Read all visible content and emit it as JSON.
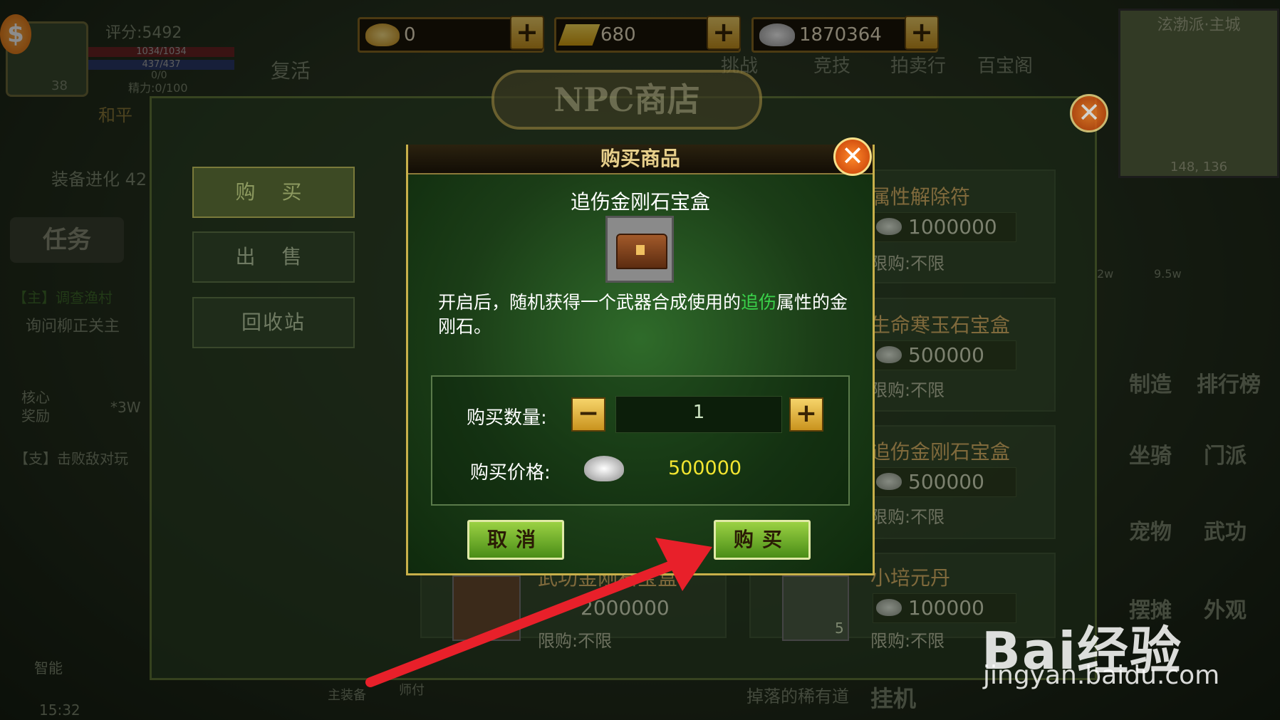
{
  "player": {
    "level": "38",
    "score": "评分:5492",
    "hp": "1034/1034",
    "mp": "437/437",
    "stat3": "0/0",
    "stamina": "精力:0/100",
    "mode": "和平"
  },
  "currencies": [
    {
      "icon": "gold-ingot-icon",
      "value": "0"
    },
    {
      "icon": "gold-bar-icon",
      "value": "680"
    },
    {
      "icon": "silver-ingot-icon",
      "value": "1870364"
    }
  ],
  "top_menu": {
    "revive": "复活",
    "challenge": "挑战",
    "arena": "竞技",
    "auction": "拍卖行",
    "treasure": "百宝阁"
  },
  "minimap": {
    "location": "泫渤派·主城",
    "coords": "148, 136"
  },
  "left_panel": {
    "equip_evolve": "装备进化",
    "equip_evolve_value": "42",
    "task_label": "任务",
    "quest1": "【主】调查渔村",
    "quest1_sub": "询问柳正关主",
    "core_reward": "核心奖励",
    "reward_amount": "*3W",
    "quest2": "【支】击败敌对玩"
  },
  "shop": {
    "title": "NPC商店",
    "tabs": [
      "购 买",
      "出 售",
      "回收站"
    ],
    "items_right": [
      {
        "name": "属性解除符",
        "price": "1000000",
        "limit": "限购:不限"
      },
      {
        "name": "生命寒玉石宝盒",
        "price": "500000",
        "limit": "限购:不限"
      },
      {
        "name": "追伤金刚石宝盒",
        "price": "500000",
        "limit": "限购:不限"
      },
      {
        "name": "小培元丹",
        "price": "100000",
        "limit": "限购:不限",
        "count": "5"
      }
    ],
    "item_left_bottom": {
      "name": "武功金刚石宝盒",
      "price": "2000000",
      "limit": "限购:不限"
    }
  },
  "dialog": {
    "title": "购买商品",
    "item_name": "追伤金刚石宝盒",
    "desc_before": "开启后，随机获得一个武器合成使用的",
    "desc_highlight": "追伤",
    "desc_after": "属性的金刚石。",
    "qty_label": "购买数量:",
    "qty_value": "1",
    "price_label": "购买价格:",
    "price_value": "500000",
    "cancel_label": "取消",
    "buy_label": "购买"
  },
  "right_icons": {
    "craft": "制造",
    "rank": "排行榜",
    "mount": "坐骑",
    "faction": "门派",
    "pet": "宠物",
    "skill": "武功",
    "stall": "摆摊",
    "appearance": "外观",
    "value1": "9.5w",
    "value2": "2w"
  },
  "bottom": {
    "time": "15:32",
    "main_equip": "主装备",
    "master": "师付",
    "chat": "掉落的稀有道",
    "auto": "挂机",
    "smart": "智能"
  },
  "watermark": {
    "logo": "Bai经验",
    "url": "jingyan.baidu.com"
  },
  "colors": {
    "accent_gold": "#e7cf8b",
    "highlight_green": "#3ad14a",
    "price_yellow": "#f2e530",
    "arrow_red": "#e8202a"
  }
}
